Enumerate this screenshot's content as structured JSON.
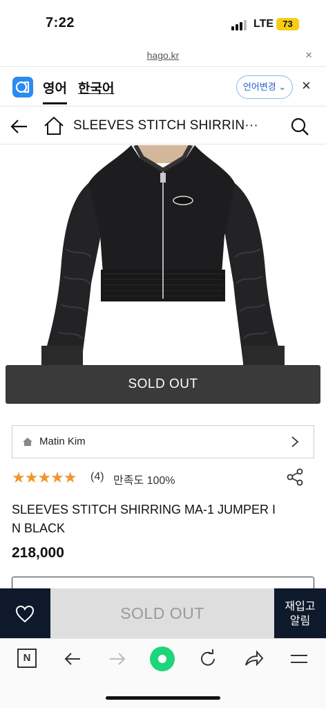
{
  "status_bar": {
    "time": "7:22",
    "network": "LTE",
    "battery": "73"
  },
  "browser": {
    "url": "hago.kr",
    "close_label": "×"
  },
  "translate_bar": {
    "source_lang": "영어",
    "target_lang": "한국어",
    "change_label": "언어변경 ⌄",
    "close_label": "×"
  },
  "nav": {
    "title": "SLEEVES STITCH SHIRRIN···"
  },
  "product": {
    "patch_text": "Matin Kim",
    "overlay_text": "SOLD OUT",
    "brand": "Matin Kim",
    "stars": "★★★★★",
    "review_count": "(4)",
    "satisfaction": "만족도 100%",
    "name": "SLEEVES STITCH SHIRRING MA-1 JUMPER IN BLACK",
    "price": "218,000"
  },
  "buy_bar": {
    "sold_out_label": "SOLD OUT",
    "restock_label": "재입고\n알림"
  },
  "toolbar": {
    "n_label": "N"
  },
  "colors": {
    "navy": "#0e1a2b",
    "star": "#f0962d",
    "accent_blue": "#2864c6",
    "green": "#1ed57a"
  }
}
